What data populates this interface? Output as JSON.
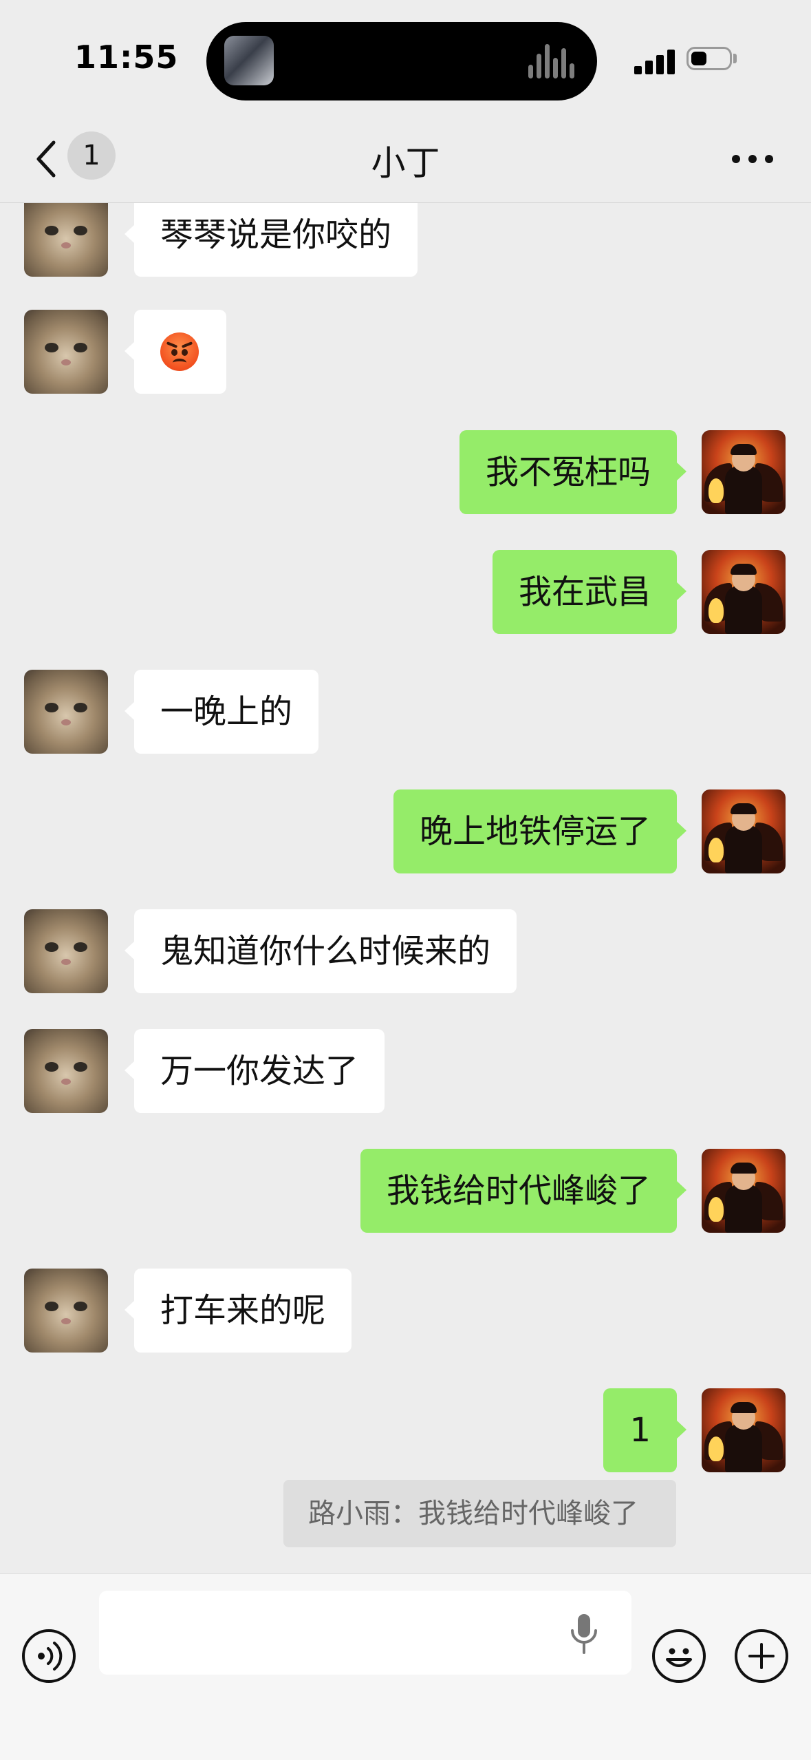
{
  "status_bar": {
    "time": "11:55",
    "icons": [
      "now-playing-art-icon",
      "audio-waveform-icon",
      "signal-icon",
      "battery-icon"
    ]
  },
  "nav": {
    "unread_count": "1",
    "title": "小丁",
    "icons": [
      "back-chevron-icon",
      "more-icon"
    ]
  },
  "messages": [
    {
      "side": "in",
      "text": "琴琴说是你咬的"
    },
    {
      "side": "in",
      "type": "emoji",
      "emoji": "angry-face-emoji"
    },
    {
      "side": "out",
      "text": "我不冤枉吗"
    },
    {
      "side": "out",
      "text": "我在武昌"
    },
    {
      "side": "in",
      "text": "一晚上的"
    },
    {
      "side": "out",
      "text": "晚上地铁停运了"
    },
    {
      "side": "in",
      "text": "鬼知道你什么时候来的"
    },
    {
      "side": "in",
      "text": "万一你发达了"
    },
    {
      "side": "out",
      "text": "我钱给时代峰峻了"
    },
    {
      "side": "in",
      "text": "打车来的呢"
    },
    {
      "side": "out",
      "text": "1"
    }
  ],
  "quote": {
    "author": "路小雨",
    "separator": "：",
    "text": "我钱给时代峰峻了"
  },
  "input_bar": {
    "value": "",
    "icons": [
      "voice-icon",
      "mic-icon",
      "emoji-icon",
      "plus-icon"
    ]
  },
  "colors": {
    "background": "#ededed",
    "incoming_bubble": "#ffffff",
    "outgoing_bubble": "#95ec69",
    "quote_background": "#dedede"
  }
}
